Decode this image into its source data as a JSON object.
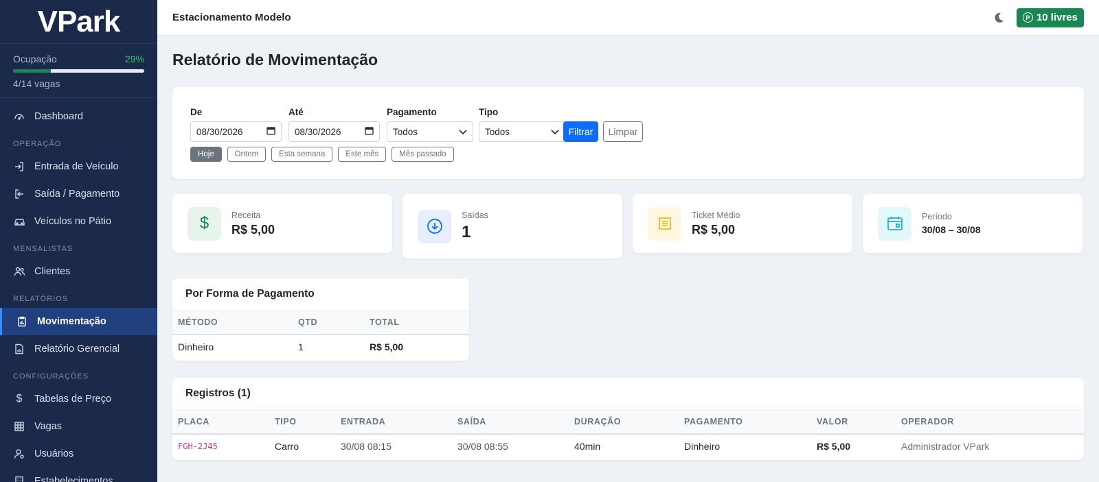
{
  "sidebar": {
    "brand": "VPark",
    "occupancy": {
      "label": "Ocupação",
      "percent": "29%",
      "fill": 0.29,
      "sub": "4/14 vagas"
    },
    "items": [
      {
        "label": "Dashboard",
        "icon": "gauge-icon"
      },
      {
        "section": "OPERAÇÃO"
      },
      {
        "label": "Entrada de Veículo",
        "icon": "sign-in-icon"
      },
      {
        "label": "Saída / Pagamento",
        "icon": "sign-out-icon"
      },
      {
        "label": "Veículos no Pátio",
        "icon": "car-icon"
      },
      {
        "section": "MENSALISTAS"
      },
      {
        "label": "Clientes",
        "icon": "people-icon"
      },
      {
        "section": "RELATÓRIOS"
      },
      {
        "label": "Movimentação",
        "icon": "clipboard-icon",
        "active": true
      },
      {
        "label": "Relatório Gerencial",
        "icon": "report-icon"
      },
      {
        "section": "CONFIGURAÇÕES"
      },
      {
        "label": "Tabelas de Preço",
        "icon": "dollar-icon"
      },
      {
        "label": "Vagas",
        "icon": "grid-icon"
      },
      {
        "label": "Usuários",
        "icon": "user-gear-icon"
      },
      {
        "label": "Estabelecimentos",
        "icon": "building-icon"
      }
    ]
  },
  "topbar": {
    "title": "Estacionamento Modelo",
    "free_badge": "10 livres",
    "badge_glyph": "P"
  },
  "page": {
    "title": "Relatório de Movimentação"
  },
  "filters": {
    "de_label": "De",
    "de_value": "08/30/2026",
    "ate_label": "Até",
    "ate_value": "08/30/2026",
    "pagamento_label": "Pagamento",
    "pagamento_value": "Todos",
    "tipo_label": "Tipo",
    "tipo_value": "Todos",
    "filter_button": "Filtrar",
    "clear_button": "Limpar",
    "quick": [
      "Hoje",
      "Ontem",
      "Esta semana",
      "Este mês",
      "Mês passado"
    ],
    "quick_active": 0
  },
  "stats": {
    "receita": {
      "label": "Receita",
      "value": "R$ 5,00"
    },
    "saidas": {
      "label": "Saídas",
      "value": "1"
    },
    "ticket": {
      "label": "Ticket Médio",
      "value": "R$ 5,00"
    },
    "periodo": {
      "label": "Período",
      "value": "30/08 – 30/08"
    }
  },
  "payments": {
    "title": "Por Forma de Pagamento",
    "headers": [
      "MÉTODO",
      "QTD",
      "TOTAL"
    ],
    "rows": [
      {
        "metodo": "Dinheiro",
        "qtd": "1",
        "total": "R$ 5,00"
      }
    ]
  },
  "records": {
    "title": "Registros (1)",
    "headers": [
      "PLACA",
      "TIPO",
      "ENTRADA",
      "SAÍDA",
      "DURAÇÃO",
      "PAGAMENTO",
      "VALOR",
      "OPERADOR"
    ],
    "rows": [
      {
        "placa": "FGH-2J45",
        "tipo": "Carro",
        "entrada": "30/08 08:15",
        "saida": "30/08 08:55",
        "duracao": "40min",
        "pagamento": "Dinheiro",
        "valor": "R$ 5,00",
        "operador": "Administrador VPark"
      }
    ]
  },
  "colors": {
    "sidebar_bg": "#1b2a4a",
    "active_bg": "#20407f",
    "primary": "#0d6efd",
    "success": "#198754",
    "plate": "#d63384"
  }
}
